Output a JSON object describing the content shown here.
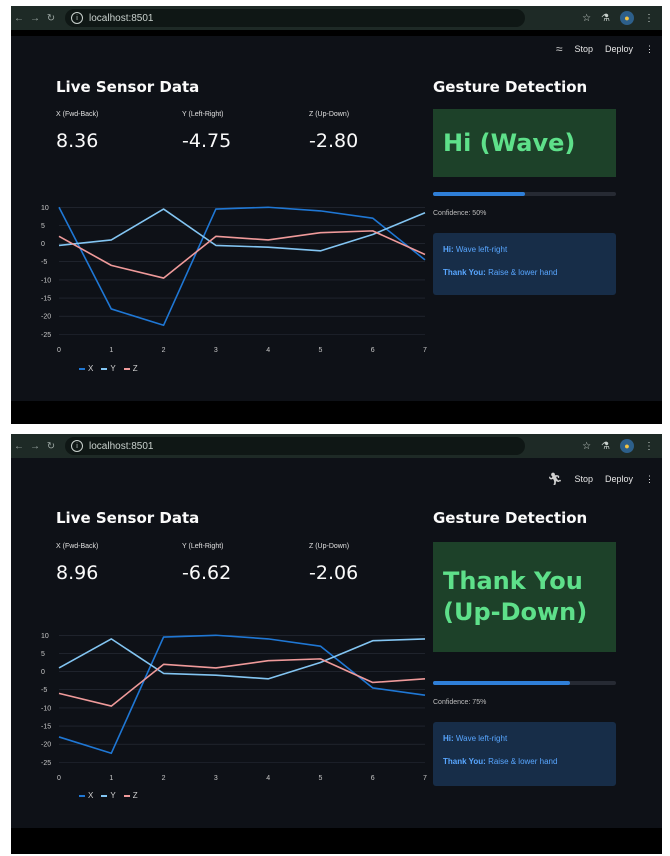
{
  "colors": {
    "x": "#1f77d4",
    "y": "#83c5f2",
    "z": "#ef9a9a",
    "gesture_text": "#5ee08a",
    "info_text": "#58a6ff"
  },
  "browser": {
    "url": "localhost:8501",
    "icons": [
      "back-arrow-icon",
      "forward-arrow-icon",
      "reload-icon",
      "info-icon",
      "star-icon",
      "flask-icon",
      "profile-icon",
      "more-icon"
    ]
  },
  "app": {
    "stop_label": "Stop",
    "deploy_label": "Deploy"
  },
  "labels": {
    "live_title": "Live Sensor Data",
    "gesture_title": "Gesture Detection",
    "x_label": "X (Fwd-Back)",
    "y_label": "Y (Left-Right)",
    "z_label": "Z (Up-Down)",
    "legend_x": "X",
    "legend_y": "Y",
    "legend_z": "Z",
    "hi_key": "Hi:",
    "hi_desc": "Wave left-right",
    "ty_key": "Thank You:",
    "ty_desc": "Raise & lower hand"
  },
  "screens": [
    {
      "metrics": {
        "x": "8.36",
        "y": "-4.75",
        "z": "-2.80"
      },
      "gesture": "Hi (Wave)",
      "confidence": "Confidence: 50%",
      "confidence_value": 0.5
    },
    {
      "metrics": {
        "x": "8.96",
        "y": "-6.62",
        "z": "-2.06"
      },
      "gesture": "Thank You (Up-Down)",
      "confidence": "Confidence: 75%",
      "confidence_value": 0.75
    }
  ],
  "chart_data": [
    {
      "type": "line",
      "x": [
        0,
        1,
        2,
        3,
        4,
        5,
        6,
        7
      ],
      "ylim": [
        -26,
        12
      ],
      "y_ticks": [
        10,
        5,
        0,
        -5,
        -10,
        -15,
        -20,
        -25
      ],
      "series": [
        {
          "name": "X",
          "values": [
            10,
            -18,
            -22.5,
            9.5,
            10,
            9,
            7,
            -4.5
          ]
        },
        {
          "name": "Y",
          "values": [
            -0.5,
            1,
            9.5,
            -0.5,
            -1,
            -2,
            2.5,
            8.5
          ]
        },
        {
          "name": "Z",
          "values": [
            2,
            -6,
            -9.5,
            2,
            1,
            3,
            3.5,
            -3
          ]
        }
      ]
    },
    {
      "type": "line",
      "x": [
        0,
        1,
        2,
        3,
        4,
        5,
        6,
        7
      ],
      "ylim": [
        -26,
        12
      ],
      "y_ticks": [
        10,
        5,
        0,
        -5,
        -10,
        -15,
        -20,
        -25
      ],
      "series": [
        {
          "name": "X",
          "values": [
            -18,
            -22.5,
            9.5,
            10,
            9,
            7,
            -4.5,
            -6.5
          ]
        },
        {
          "name": "Y",
          "values": [
            1,
            9,
            -0.5,
            -1,
            -2,
            2.5,
            8.5,
            9
          ]
        },
        {
          "name": "Z",
          "values": [
            -6,
            -9.5,
            2,
            1,
            3,
            3.5,
            -3,
            -2
          ]
        }
      ]
    }
  ]
}
